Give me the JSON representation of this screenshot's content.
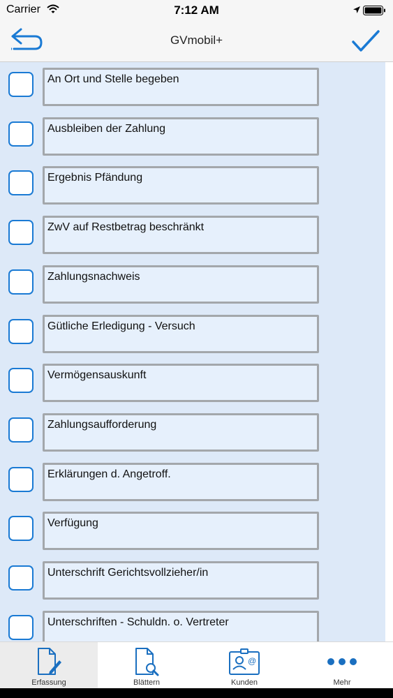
{
  "status_bar": {
    "carrier": "Carrier",
    "time": "7:12 AM"
  },
  "nav": {
    "title": "GVmobil+",
    "back_icon": "back-arrow-icon",
    "done_icon": "checkmark-icon"
  },
  "items": [
    {
      "label": "An Ort und Stelle begeben",
      "checked": false
    },
    {
      "label": "Ausbleiben der Zahlung",
      "checked": false
    },
    {
      "label": "Ergebnis Pfändung",
      "checked": false
    },
    {
      "label": "ZwV auf Restbetrag beschränkt",
      "checked": false
    },
    {
      "label": "Zahlungsnachweis",
      "checked": false
    },
    {
      "label": "Gütliche Erledigung - Versuch",
      "checked": false
    },
    {
      "label": "Vermögensauskunft",
      "checked": false
    },
    {
      "label": "Zahlungsaufforderung",
      "checked": false
    },
    {
      "label": "Erklärungen d. Angetroff.",
      "checked": false
    },
    {
      "label": "Verfügung",
      "checked": false
    },
    {
      "label": "Unterschrift Gerichtsvollzieher/in",
      "checked": false
    },
    {
      "label": "Unterschriften - Schuldn. o. Vertreter",
      "checked": false
    }
  ],
  "tabs": [
    {
      "label": "Erfassung",
      "icon": "edit-document-icon",
      "active": true
    },
    {
      "label": "Blättern",
      "icon": "search-document-icon",
      "active": false
    },
    {
      "label": "Kunden",
      "icon": "contact-card-icon",
      "active": false
    },
    {
      "label": "Mehr",
      "icon": "more-dots-icon",
      "active": false
    }
  ],
  "colors": {
    "accent": "#1a7ad4",
    "content_background": "#dde9f8",
    "field_background": "#e6f0fc",
    "field_border": "#a3a7ab"
  }
}
